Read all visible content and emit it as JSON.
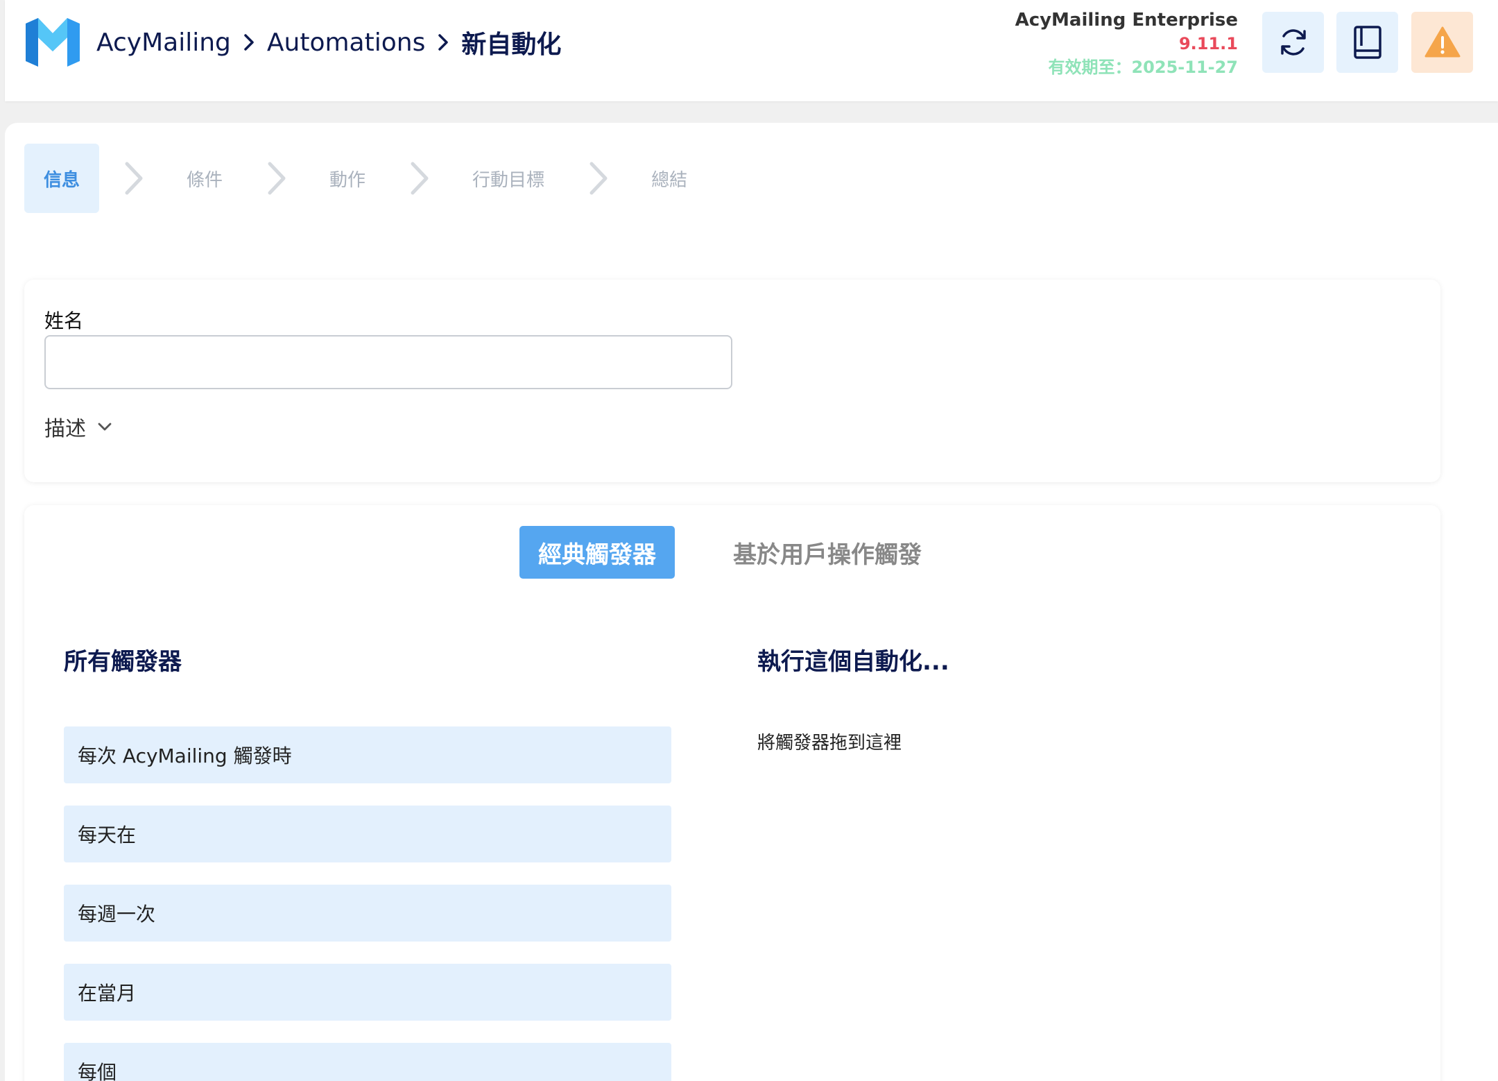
{
  "header": {
    "breadcrumb": [
      "AcyMailing",
      "Automations",
      "新自動化"
    ],
    "edition": "AcyMailing Enterprise",
    "version": "9.11.1",
    "expiry": "有效期至：2025-11-27",
    "buttons": [
      {
        "icon": "refresh-icon"
      },
      {
        "icon": "book-icon"
      },
      {
        "icon": "warning-icon"
      }
    ]
  },
  "steps": [
    "信息",
    "條件",
    "動作",
    "行動目標",
    "總結"
  ],
  "info": {
    "name_label": "姓名",
    "name_value": "",
    "description_label": "描述"
  },
  "triggers": {
    "tabs": [
      "經典觸發器",
      "基於用戶操作觸發"
    ],
    "all_title": "所有觸發器",
    "run_title": "執行這個自動化...",
    "drop_hint": "將觸發器拖到這裡",
    "items": [
      "每次 AcyMailing 觸發時",
      "每天在",
      "每週一次",
      "在當月",
      "每個"
    ]
  },
  "colors": {
    "accent": "#55a6f0",
    "navy": "#0d1a4f",
    "version_red": "#e9495a",
    "expiry_green": "#8fe3b8",
    "item_bg": "#e3f0fd"
  }
}
